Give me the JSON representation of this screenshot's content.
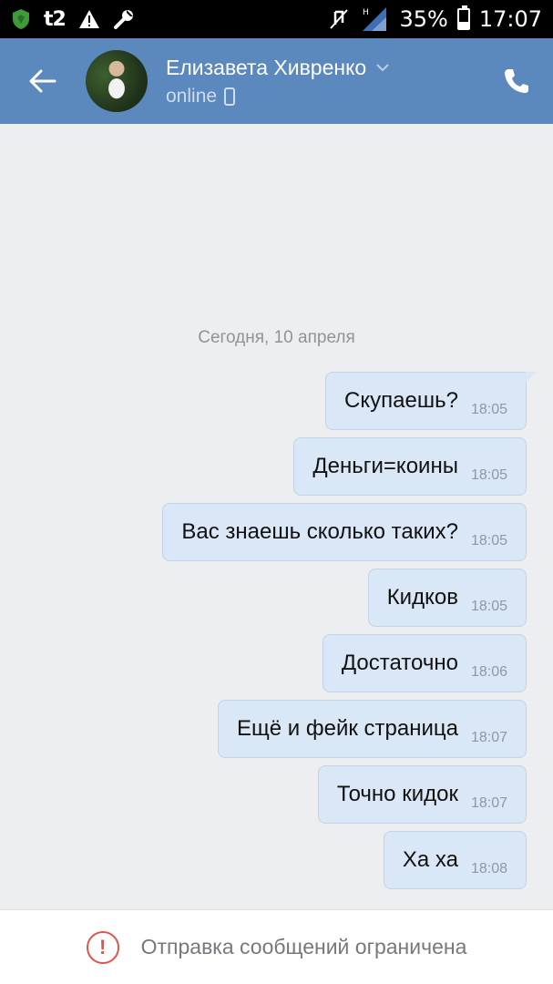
{
  "status_bar": {
    "carrier": "t2",
    "network": "H",
    "battery": "35%",
    "battery_level": 0.35,
    "time": "17:07"
  },
  "header": {
    "contact_name": "Елизавета Хивренко",
    "contact_status": "online"
  },
  "chat": {
    "date_separator": "Сегодня, 10 апреля",
    "messages": [
      {
        "text": "Скупаешь?",
        "time": "18:05"
      },
      {
        "text": "Деньги=коины",
        "time": "18:05"
      },
      {
        "text": "Вас знаешь сколько таких?",
        "time": "18:05"
      },
      {
        "text": "Кидков",
        "time": "18:05"
      },
      {
        "text": "Достаточно",
        "time": "18:06"
      },
      {
        "text": "Ещё и фейк страница",
        "time": "18:07"
      },
      {
        "text": "Точно кидок",
        "time": "18:07"
      },
      {
        "text": "Ха ха",
        "time": "18:08"
      }
    ]
  },
  "footer": {
    "notice": "Отправка сообщений ограничена"
  },
  "colors": {
    "header": "#5b88bd",
    "bubble": "#d9e7f7",
    "background": "#edeef0",
    "warning": "#e3534a"
  }
}
